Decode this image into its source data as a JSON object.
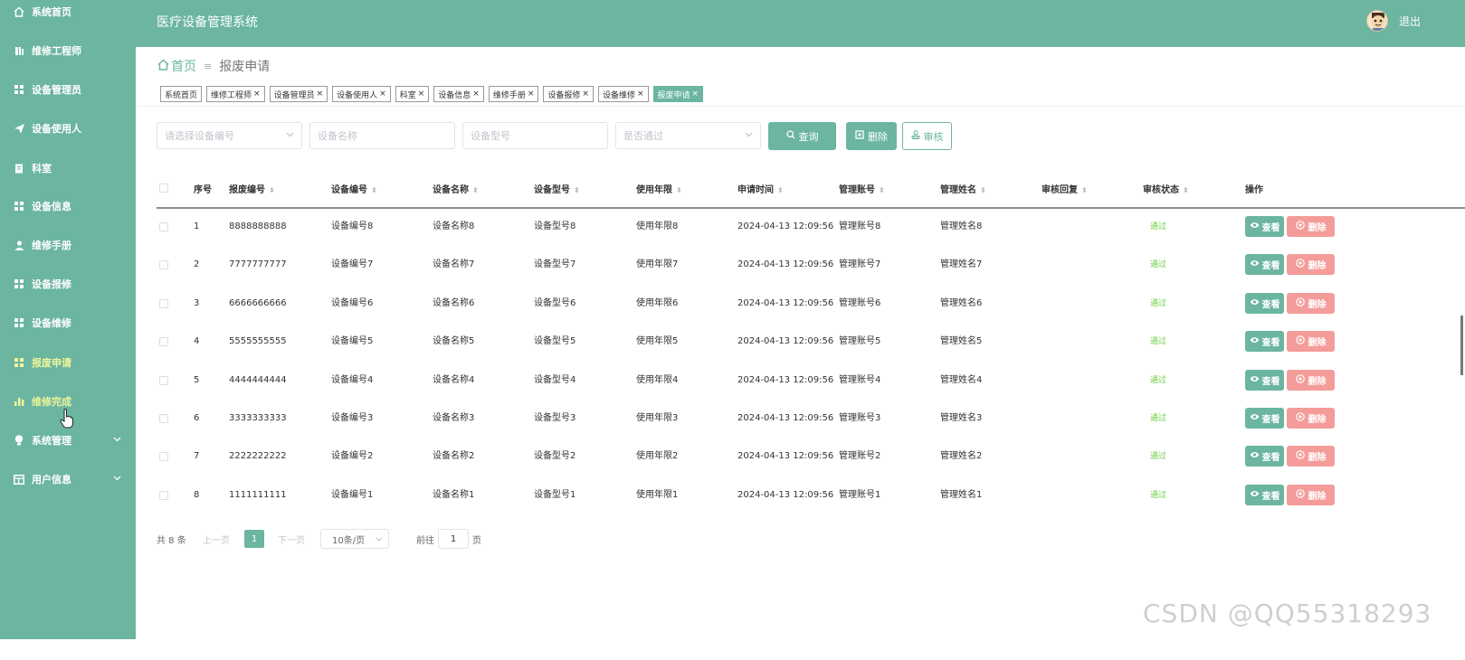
{
  "app": {
    "title": "医疗设备管理系统",
    "logout": "退出"
  },
  "sidebar": {
    "items": [
      {
        "label": "系统首页",
        "icon": "home-icon"
      },
      {
        "label": "维修工程师",
        "icon": "book-icon"
      },
      {
        "label": "设备管理员",
        "icon": "grid-icon"
      },
      {
        "label": "设备使用人",
        "icon": "send-icon"
      },
      {
        "label": "科室",
        "icon": "document-icon"
      },
      {
        "label": "设备信息",
        "icon": "grid-icon"
      },
      {
        "label": "维修手册",
        "icon": "user-icon"
      },
      {
        "label": "设备报修",
        "icon": "grid-icon"
      },
      {
        "label": "设备维修",
        "icon": "grid-icon"
      },
      {
        "label": "报废申请",
        "icon": "grid-icon"
      },
      {
        "label": "维修完成",
        "icon": "bar-chart-icon"
      },
      {
        "label": "系统管理",
        "icon": "bulb-icon"
      },
      {
        "label": "用户信息",
        "icon": "card-icon"
      }
    ]
  },
  "breadcrumb": {
    "home": "首页",
    "sep": "≡",
    "current": "报废申请"
  },
  "tags": [
    {
      "label": "系统首页"
    },
    {
      "label": "维修工程师"
    },
    {
      "label": "设备管理员"
    },
    {
      "label": "设备使用人"
    },
    {
      "label": "科室"
    },
    {
      "label": "设备信息"
    },
    {
      "label": "维修手册"
    },
    {
      "label": "设备报修"
    },
    {
      "label": "设备维修"
    },
    {
      "label": "报废申请"
    }
  ],
  "tag_close": "×",
  "filters": {
    "device_no_placeholder": "请选择设备编号",
    "device_name_placeholder": "设备名称",
    "device_model_placeholder": "设备型号",
    "passed_placeholder": "是否通过"
  },
  "buttons": {
    "search": "查询",
    "delete": "删除",
    "audit": "审核"
  },
  "table": {
    "headers": [
      "序号",
      "报废编号",
      "设备编号",
      "设备名称",
      "设备型号",
      "使用年限",
      "申请时间",
      "管理账号",
      "管理姓名",
      "审核回复",
      "审核状态",
      "操作"
    ],
    "rows": [
      [
        "1",
        "8888888888",
        "设备编号8",
        "设备名称8",
        "设备型号8",
        "使用年限8",
        "2024-04-13 12:09:56",
        "管理账号8",
        "管理姓名8",
        "",
        "通过"
      ],
      [
        "2",
        "7777777777",
        "设备编号7",
        "设备名称7",
        "设备型号7",
        "使用年限7",
        "2024-04-13 12:09:56",
        "管理账号7",
        "管理姓名7",
        "",
        "通过"
      ],
      [
        "3",
        "6666666666",
        "设备编号6",
        "设备名称6",
        "设备型号6",
        "使用年限6",
        "2024-04-13 12:09:56",
        "管理账号6",
        "管理姓名6",
        "",
        "通过"
      ],
      [
        "4",
        "5555555555",
        "设备编号5",
        "设备名称5",
        "设备型号5",
        "使用年限5",
        "2024-04-13 12:09:56",
        "管理账号5",
        "管理姓名5",
        "",
        "通过"
      ],
      [
        "5",
        "4444444444",
        "设备编号4",
        "设备名称4",
        "设备型号4",
        "使用年限4",
        "2024-04-13 12:09:56",
        "管理账号4",
        "管理姓名4",
        "",
        "通过"
      ],
      [
        "6",
        "3333333333",
        "设备编号3",
        "设备名称3",
        "设备型号3",
        "使用年限3",
        "2024-04-13 12:09:56",
        "管理账号3",
        "管理姓名3",
        "",
        "通过"
      ],
      [
        "7",
        "2222222222",
        "设备编号2",
        "设备名称2",
        "设备型号2",
        "使用年限2",
        "2024-04-13 12:09:56",
        "管理账号2",
        "管理姓名2",
        "",
        "通过"
      ],
      [
        "8",
        "1111111111",
        "设备编号1",
        "设备名称1",
        "设备型号1",
        "使用年限1",
        "2024-04-13 12:09:56",
        "管理账号1",
        "管理姓名1",
        "",
        "通过"
      ]
    ],
    "view_label": "查看",
    "delete_label": "删除"
  },
  "pagination": {
    "total": "共 8 条",
    "prev": "上一页",
    "page": "1",
    "next": "下一页",
    "page_size": "10条/页",
    "goto": "前往",
    "goto_value": "1",
    "page_unit": "页"
  },
  "watermark": "CSDN @QQ55318293",
  "colors": {
    "primary": "#6bb5a1",
    "danger": "#f39c99",
    "pass": "#6ccf3f",
    "active_menu": "#f0f59a"
  }
}
